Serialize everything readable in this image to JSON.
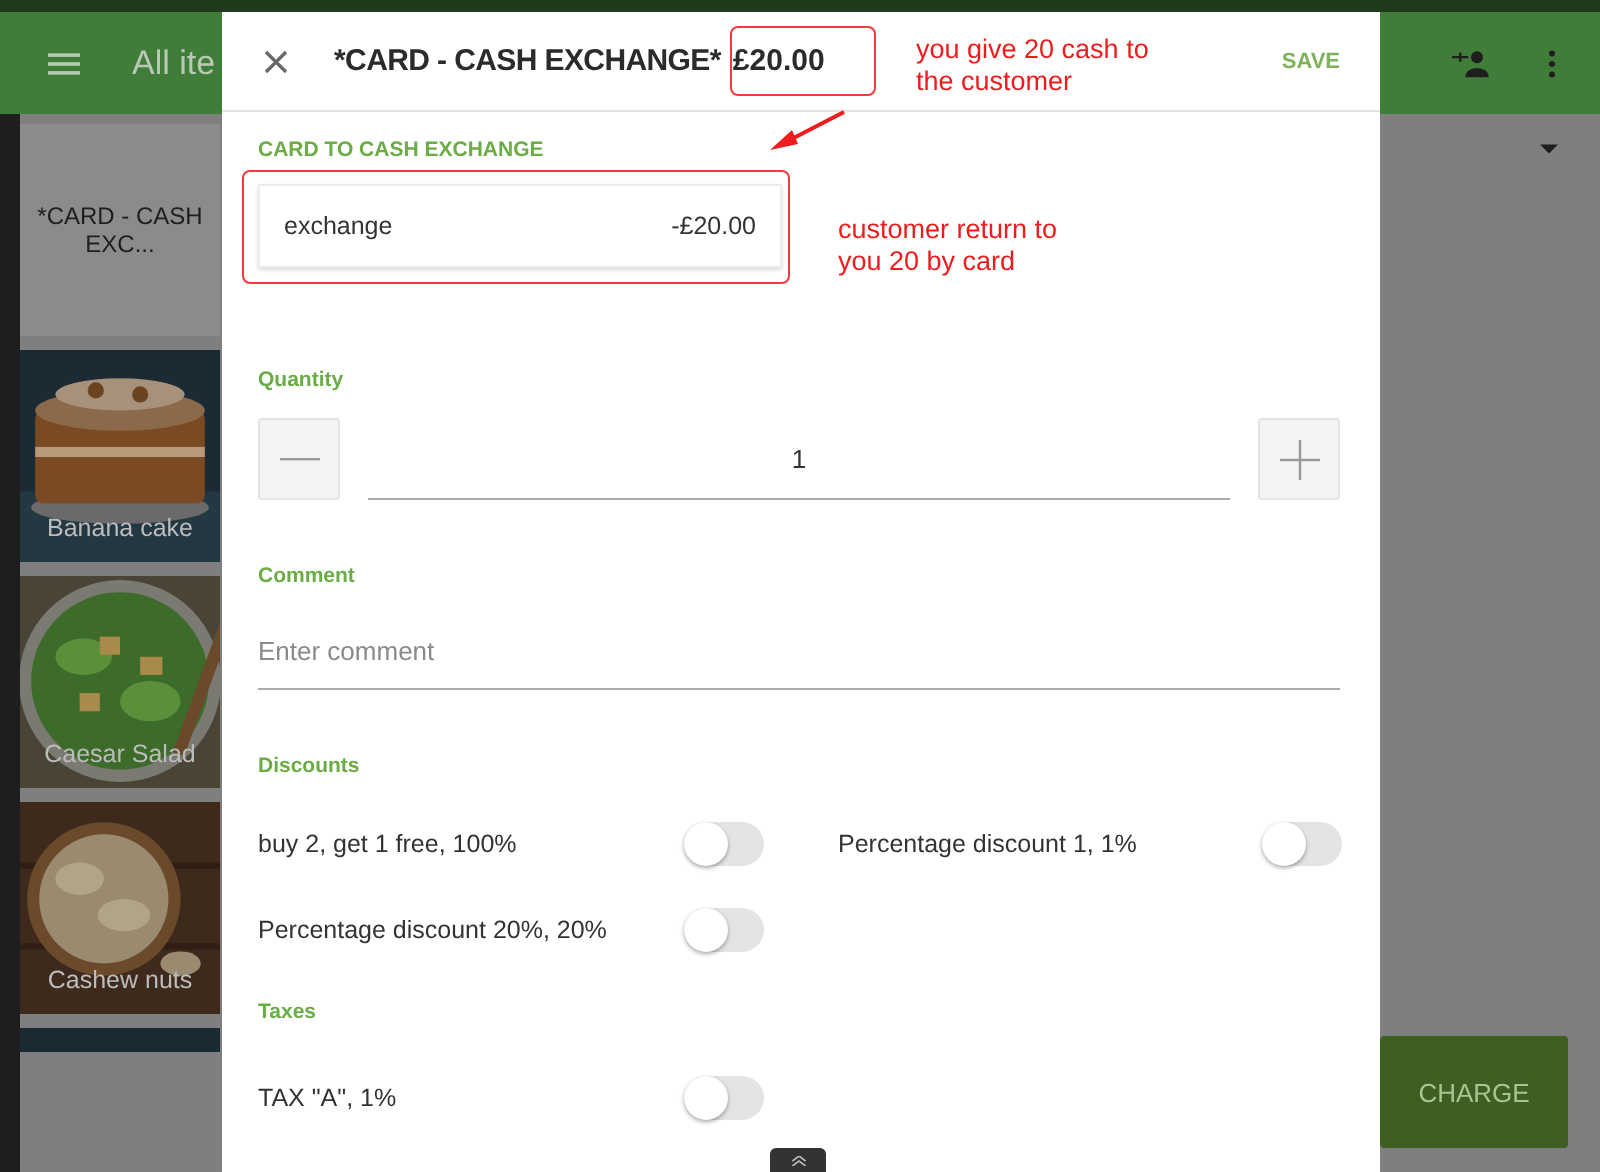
{
  "app_bar": {
    "title": "All ite"
  },
  "items": [
    {
      "kind": "text",
      "label": "*CARD - CASH EXC..."
    },
    {
      "kind": "picture",
      "label": "Banana cake"
    },
    {
      "kind": "picture",
      "label": "Caesar Salad"
    },
    {
      "kind": "picture",
      "label": "Cashew nuts"
    },
    {
      "kind": "picture"
    }
  ],
  "charge_button": "CHARGE",
  "dialog": {
    "title": "*CARD - CASH EXCHANGE*",
    "price": "£20.00",
    "save": "SAVE",
    "section": "CARD TO CASH EXCHANGE",
    "option": {
      "name": "exchange",
      "price": "-£20.00"
    },
    "quantity": {
      "label": "Quantity",
      "value": "1"
    },
    "comment": {
      "label": "Comment",
      "placeholder": "Enter comment"
    },
    "discounts": {
      "label": "Discounts",
      "items": [
        {
          "label": "buy 2, get 1 free, 100%",
          "on": false
        },
        {
          "label": "Percentage discount 1, 1%",
          "on": false
        },
        {
          "label": "Percentage discount 20%, 20%",
          "on": false
        }
      ]
    },
    "taxes": {
      "label": "Taxes",
      "items": [
        {
          "label": "TAX \"A\", 1%",
          "on": false
        }
      ]
    }
  },
  "annotations": [
    {
      "text": "you give 20 cash to the customer"
    },
    {
      "text": "customer return to you 20 by card"
    }
  ]
}
